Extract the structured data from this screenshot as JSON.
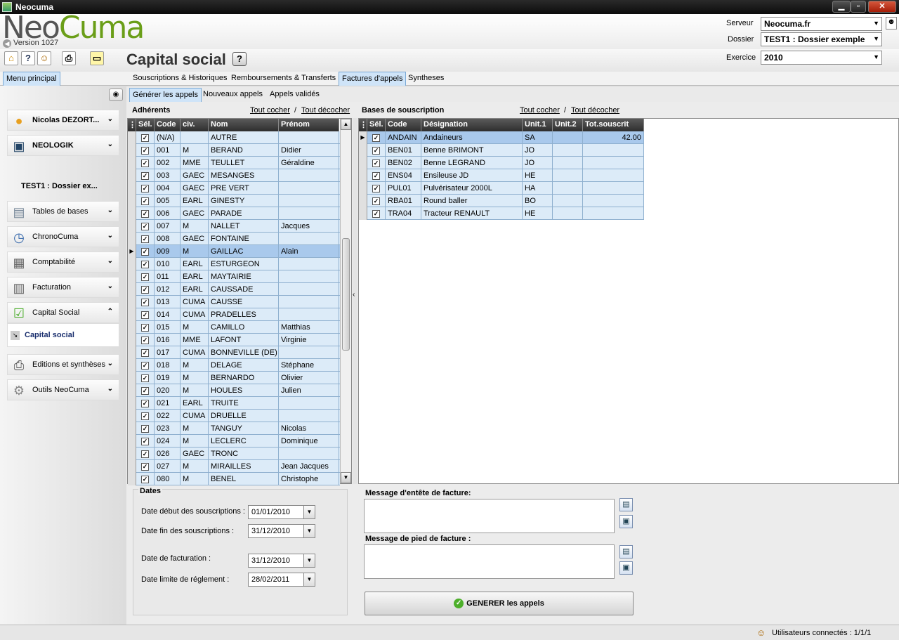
{
  "window": {
    "title": "Neocuma"
  },
  "header": {
    "logo_neo": "Neo",
    "logo_cuma": "Cuma",
    "version": "Version 1027",
    "serveur_label": "Serveur",
    "serveur_value": "Neocuma.fr",
    "dossier_label": "Dossier",
    "dossier_value": "TEST1 : Dossier exemple",
    "exercice_label": "Exercice",
    "exercice_value": "2010"
  },
  "toolbar": {
    "page_title": "Capital social",
    "help": "?"
  },
  "tabs_main": [
    {
      "label": "Menu principal"
    },
    {
      "label": "Souscriptions & Historiques"
    },
    {
      "label": "Remboursements & Transferts"
    },
    {
      "label": "Factures d'appels"
    },
    {
      "label": "Syntheses"
    }
  ],
  "tabs_sub": [
    {
      "label": "Générer les appels"
    },
    {
      "label": "Nouveaux appels"
    },
    {
      "label": "Appels validés"
    }
  ],
  "sidebar": {
    "user": "Nicolas DEZORT...",
    "company": "NEOLOGIK",
    "dossier": "TEST1 : Dossier ex...",
    "items": [
      {
        "label": "Tables de bases",
        "icon": "folder-icon"
      },
      {
        "label": "ChronoCuma",
        "icon": "clock-icon"
      },
      {
        "label": "Comptabilité",
        "icon": "calculator-icon"
      },
      {
        "label": "Facturation",
        "icon": "invoice-icon"
      },
      {
        "label": "Capital Social",
        "icon": "checklist-icon"
      },
      {
        "label": "Editions et synthèses",
        "icon": "printer-icon"
      },
      {
        "label": "Outils NeoCuma",
        "icon": "gear-icon"
      }
    ],
    "active_sub": "Capital social"
  },
  "adherents": {
    "title": "Adhérents",
    "check_all": "Tout cocher",
    "uncheck_all": "Tout décocher",
    "sep": "/",
    "columns": [
      "Sél.",
      "Code",
      "civ.",
      "Nom",
      "Prénom"
    ],
    "rows": [
      [
        "(N/A)",
        "",
        "AUTRE",
        ""
      ],
      [
        "001",
        "M",
        "BERAND",
        "Didier"
      ],
      [
        "002",
        "MME",
        "TEULLET",
        "Géraldine"
      ],
      [
        "003",
        "GAEC",
        "MESANGES",
        ""
      ],
      [
        "004",
        "GAEC",
        "PRE VERT",
        ""
      ],
      [
        "005",
        "EARL",
        "GINESTY",
        ""
      ],
      [
        "006",
        "GAEC",
        "PARADE",
        ""
      ],
      [
        "007",
        "M",
        "NALLET",
        "Jacques"
      ],
      [
        "008",
        "GAEC",
        "FONTAINE",
        ""
      ],
      [
        "009",
        "M",
        "GAILLAC",
        "Alain"
      ],
      [
        "010",
        "EARL",
        "ESTURGEON",
        ""
      ],
      [
        "011",
        "EARL",
        "MAYTAIRIE",
        ""
      ],
      [
        "012",
        "EARL",
        "CAUSSADE",
        ""
      ],
      [
        "013",
        "CUMA",
        "CAUSSE",
        ""
      ],
      [
        "014",
        "CUMA",
        "PRADELLES",
        ""
      ],
      [
        "015",
        "M",
        "CAMILLO",
        "Matthias"
      ],
      [
        "016",
        "MME",
        "LAFONT",
        "Virginie"
      ],
      [
        "017",
        "CUMA",
        "BONNEVILLE (DE)",
        ""
      ],
      [
        "018",
        "M",
        "DELAGE",
        "Stéphane"
      ],
      [
        "019",
        "M",
        "BERNARDO",
        "Olivier"
      ],
      [
        "020",
        "M",
        "HOULES",
        "Julien"
      ],
      [
        "021",
        "EARL",
        "TRUITE",
        ""
      ],
      [
        "022",
        "CUMA",
        "DRUELLE",
        ""
      ],
      [
        "023",
        "M",
        "TANGUY",
        "Nicolas"
      ],
      [
        "024",
        "M",
        "LECLERC",
        "Dominique"
      ],
      [
        "026",
        "GAEC",
        "TRONC",
        ""
      ],
      [
        "027",
        "M",
        "MIRAILLES",
        "Jean Jacques"
      ],
      [
        "080",
        "M",
        "BENEL",
        "Christophe"
      ]
    ],
    "current_row": 9
  },
  "bases": {
    "title": "Bases de souscription",
    "check_all": "Tout cocher",
    "uncheck_all": "Tout décocher",
    "sep": "/",
    "columns": [
      "Sél.",
      "Code",
      "Désignation",
      "Unit.1",
      "Unit.2",
      "Tot.souscrit"
    ],
    "rows": [
      [
        "ANDAIN",
        "Andaineurs",
        "SA",
        "",
        "42.00"
      ],
      [
        "BEN01",
        "Benne BRIMONT",
        "JO",
        "",
        ""
      ],
      [
        "BEN02",
        "Benne LEGRAND",
        "JO",
        "",
        ""
      ],
      [
        "ENS04",
        "Ensileuse JD",
        "HE",
        "",
        ""
      ],
      [
        "PUL01",
        "Pulvérisateur 2000L",
        "HA",
        "",
        ""
      ],
      [
        "RBA01",
        "Round baller",
        "BO",
        "",
        ""
      ],
      [
        "TRA04",
        "Tracteur RENAULT",
        "HE",
        "",
        ""
      ]
    ],
    "current_row": 0
  },
  "dates": {
    "title": "Dates",
    "debut_label": "Date début des souscriptions :",
    "debut_value": "01/01/2010",
    "fin_label": "Date fin des souscriptions :",
    "fin_value": "31/12/2010",
    "facturation_label": "Date de facturation :",
    "facturation_value": "31/12/2010",
    "limite_label": "Date limite de réglement :",
    "limite_value": "28/02/2011"
  },
  "messages": {
    "entete_label": "Message d'entête de facture:",
    "pied_label": "Message de pied de facture :"
  },
  "generate_button": "GENERER les appels",
  "status": {
    "users": "Utilisateurs connectés : 1/1/1"
  }
}
